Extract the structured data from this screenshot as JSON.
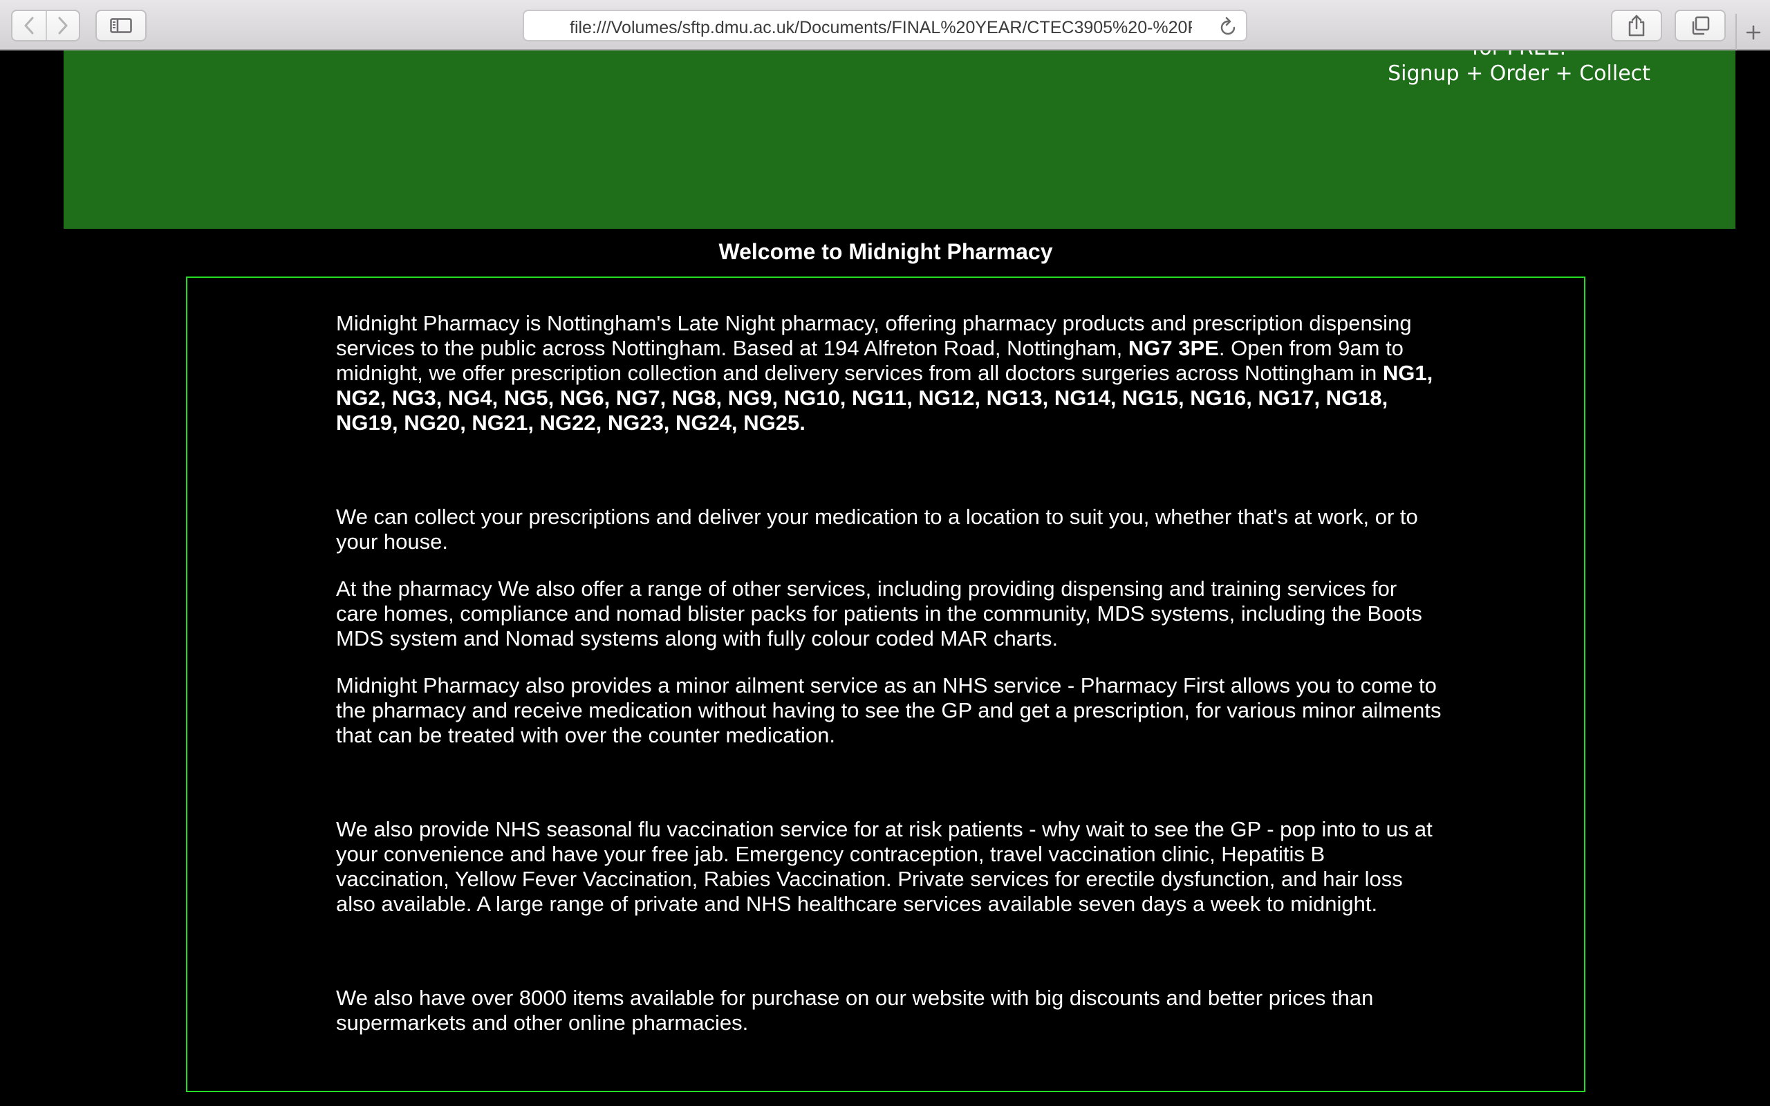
{
  "browser": {
    "url": "file:///Volumes/sftp.dmu.ac.uk/Documents/FINAL%20YEAR/CTEC3905%20-%20F",
    "icons": {
      "back": "chevron-left-icon",
      "forward": "chevron-right-icon",
      "sidebar": "sidebar-icon",
      "reload": "reload-icon",
      "share": "share-icon",
      "tabs": "tabs-icon",
      "new_tab": "plus-icon"
    }
  },
  "header": {
    "background_color": "#1e6e1a",
    "promo_line_1": "for FREE.",
    "promo_line_2": "Signup + Order + Collect"
  },
  "main": {
    "title": "Welcome to Midnight Pharmacy",
    "border_color": "#22dd22",
    "p1": {
      "text_a": "Midnight Pharmacy is Nottingham's Late Night pharmacy, offering pharmacy products and prescription dispensing services to the public across Nottingham. Based at 194 Alfreton Road, Nottingham, ",
      "postcode": "NG7 3PE",
      "text_b": ". Open from 9am to midnight, we offer prescription collection and delivery services from all doctors surgeries across Nottingham in ",
      "areas": "NG1, NG2, NG3, NG4, NG5, NG6, NG7, NG8, NG9, NG10, NG11, NG12, NG13, NG14, NG15, NG16, NG17, NG18, NG19, NG20, NG21, NG22, NG23, NG24, NG25."
    },
    "p2": "We can collect your prescriptions and deliver your medication to a location to suit you, whether that's at work, or to your house.",
    "p3": "At the pharmacy We also offer a range of other services, including providing dispensing and training services for care homes, compliance and nomad blister packs for patients in the community, MDS systems, including the Boots MDS system and Nomad systems along with fully colour coded MAR charts.",
    "p4": "Midnight Pharmacy also provides a minor ailment service as an NHS service - Pharmacy First allows you to come to the pharmacy and receive medication without having to see the GP and get a prescription, for various minor ailments that can be treated with over the counter medication.",
    "p5": "We also provide NHS seasonal flu vaccination service for at risk patients - why wait to see the GP - pop into to us at your convenience and have your free jab. Emergency contraception, travel vaccination clinic, Hepatitis B vaccination, Yellow Fever Vaccination, Rabies Vaccination. Private services for erectile dysfunction, and hair loss also available. A large range of private and NHS healthcare services available seven days a week to midnight.",
    "p6": "We also have over 8000 items available for purchase on our website with big discounts and better prices than supermarkets and other online pharmacies."
  }
}
